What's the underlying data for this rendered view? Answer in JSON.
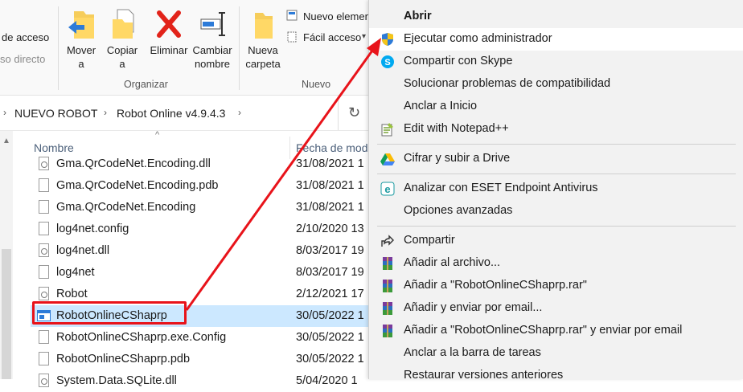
{
  "ribbon": {
    "left_text_1": "de acceso",
    "left_text_2": "so directo",
    "buttons": {
      "move": [
        "Mover",
        "a"
      ],
      "copy": [
        "Copiar",
        "a"
      ],
      "delete": "Eliminar",
      "rename": [
        "Cambiar",
        "nombre"
      ],
      "new_folder": [
        "Nueva",
        "carpeta"
      ]
    },
    "new_item": "Nuevo elemen",
    "easy_access": "Fácil acceso",
    "group_organize": "Organizar",
    "group_new": "Nuevo"
  },
  "address": {
    "crumbs": [
      "NUEVO ROBOT",
      "Robot Online v4.9.4.3"
    ]
  },
  "columns": {
    "name": "Nombre",
    "date": "Fecha de mod"
  },
  "files": [
    {
      "name": "Gma.QrCodeNet.Encoding.dll",
      "date": "31/08/2021 1",
      "icon": "dll-file-icon"
    },
    {
      "name": "Gma.QrCodeNet.Encoding.pdb",
      "date": "31/08/2021 1",
      "icon": "file-icon"
    },
    {
      "name": "Gma.QrCodeNet.Encoding",
      "date": "31/08/2021 1",
      "icon": "file-icon"
    },
    {
      "name": "log4net.config",
      "date": "2/10/2020 13",
      "icon": "file-icon"
    },
    {
      "name": "log4net.dll",
      "date": "8/03/2017 19",
      "icon": "dll-file-icon"
    },
    {
      "name": "log4net",
      "date": "8/03/2017 19",
      "icon": "file-icon"
    },
    {
      "name": "Robot",
      "date": "2/12/2021 17",
      "icon": "dll-file-icon"
    },
    {
      "name": "RobotOnlineCShaprp",
      "date": "30/05/2022 1",
      "icon": "exe-file-icon"
    },
    {
      "name": "RobotOnlineCShaprp.exe.Config",
      "date": "30/05/2022 1",
      "icon": "file-icon"
    },
    {
      "name": "RobotOnlineCShaprp.pdb",
      "date": "30/05/2022 1",
      "icon": "file-icon"
    },
    {
      "name": "System.Data.SQLite.dll",
      "date": "5/04/2020 1",
      "icon": "dll-file-icon"
    }
  ],
  "menu": {
    "open": "Abrir",
    "run_as_admin": "Ejecutar como administrador",
    "share_skype": "Compartir con Skype",
    "troubleshoot": "Solucionar problemas de compatibilidad",
    "pin_start": "Anclar a Inicio",
    "edit_notepad": "Edit with Notepad++",
    "drive": "Cifrar y subir a Drive",
    "eset": "Analizar con ESET Endpoint Antivirus",
    "advanced": "Opciones avanzadas",
    "share": "Compartir",
    "add_archive": "Añadir al archivo...",
    "add_rar": "Añadir a \"RobotOnlineCShaprp.rar\"",
    "add_email": "Añadir y enviar por email...",
    "add_rar_email": "Añadir a \"RobotOnlineCShaprp.rar\" y enviar por email",
    "pin_taskbar": "Anclar a la barra de tareas",
    "restore": "Restaurar versiones anteriores"
  },
  "colors": {
    "annotation_red": "#e8131a",
    "selection": "#cce8ff"
  }
}
